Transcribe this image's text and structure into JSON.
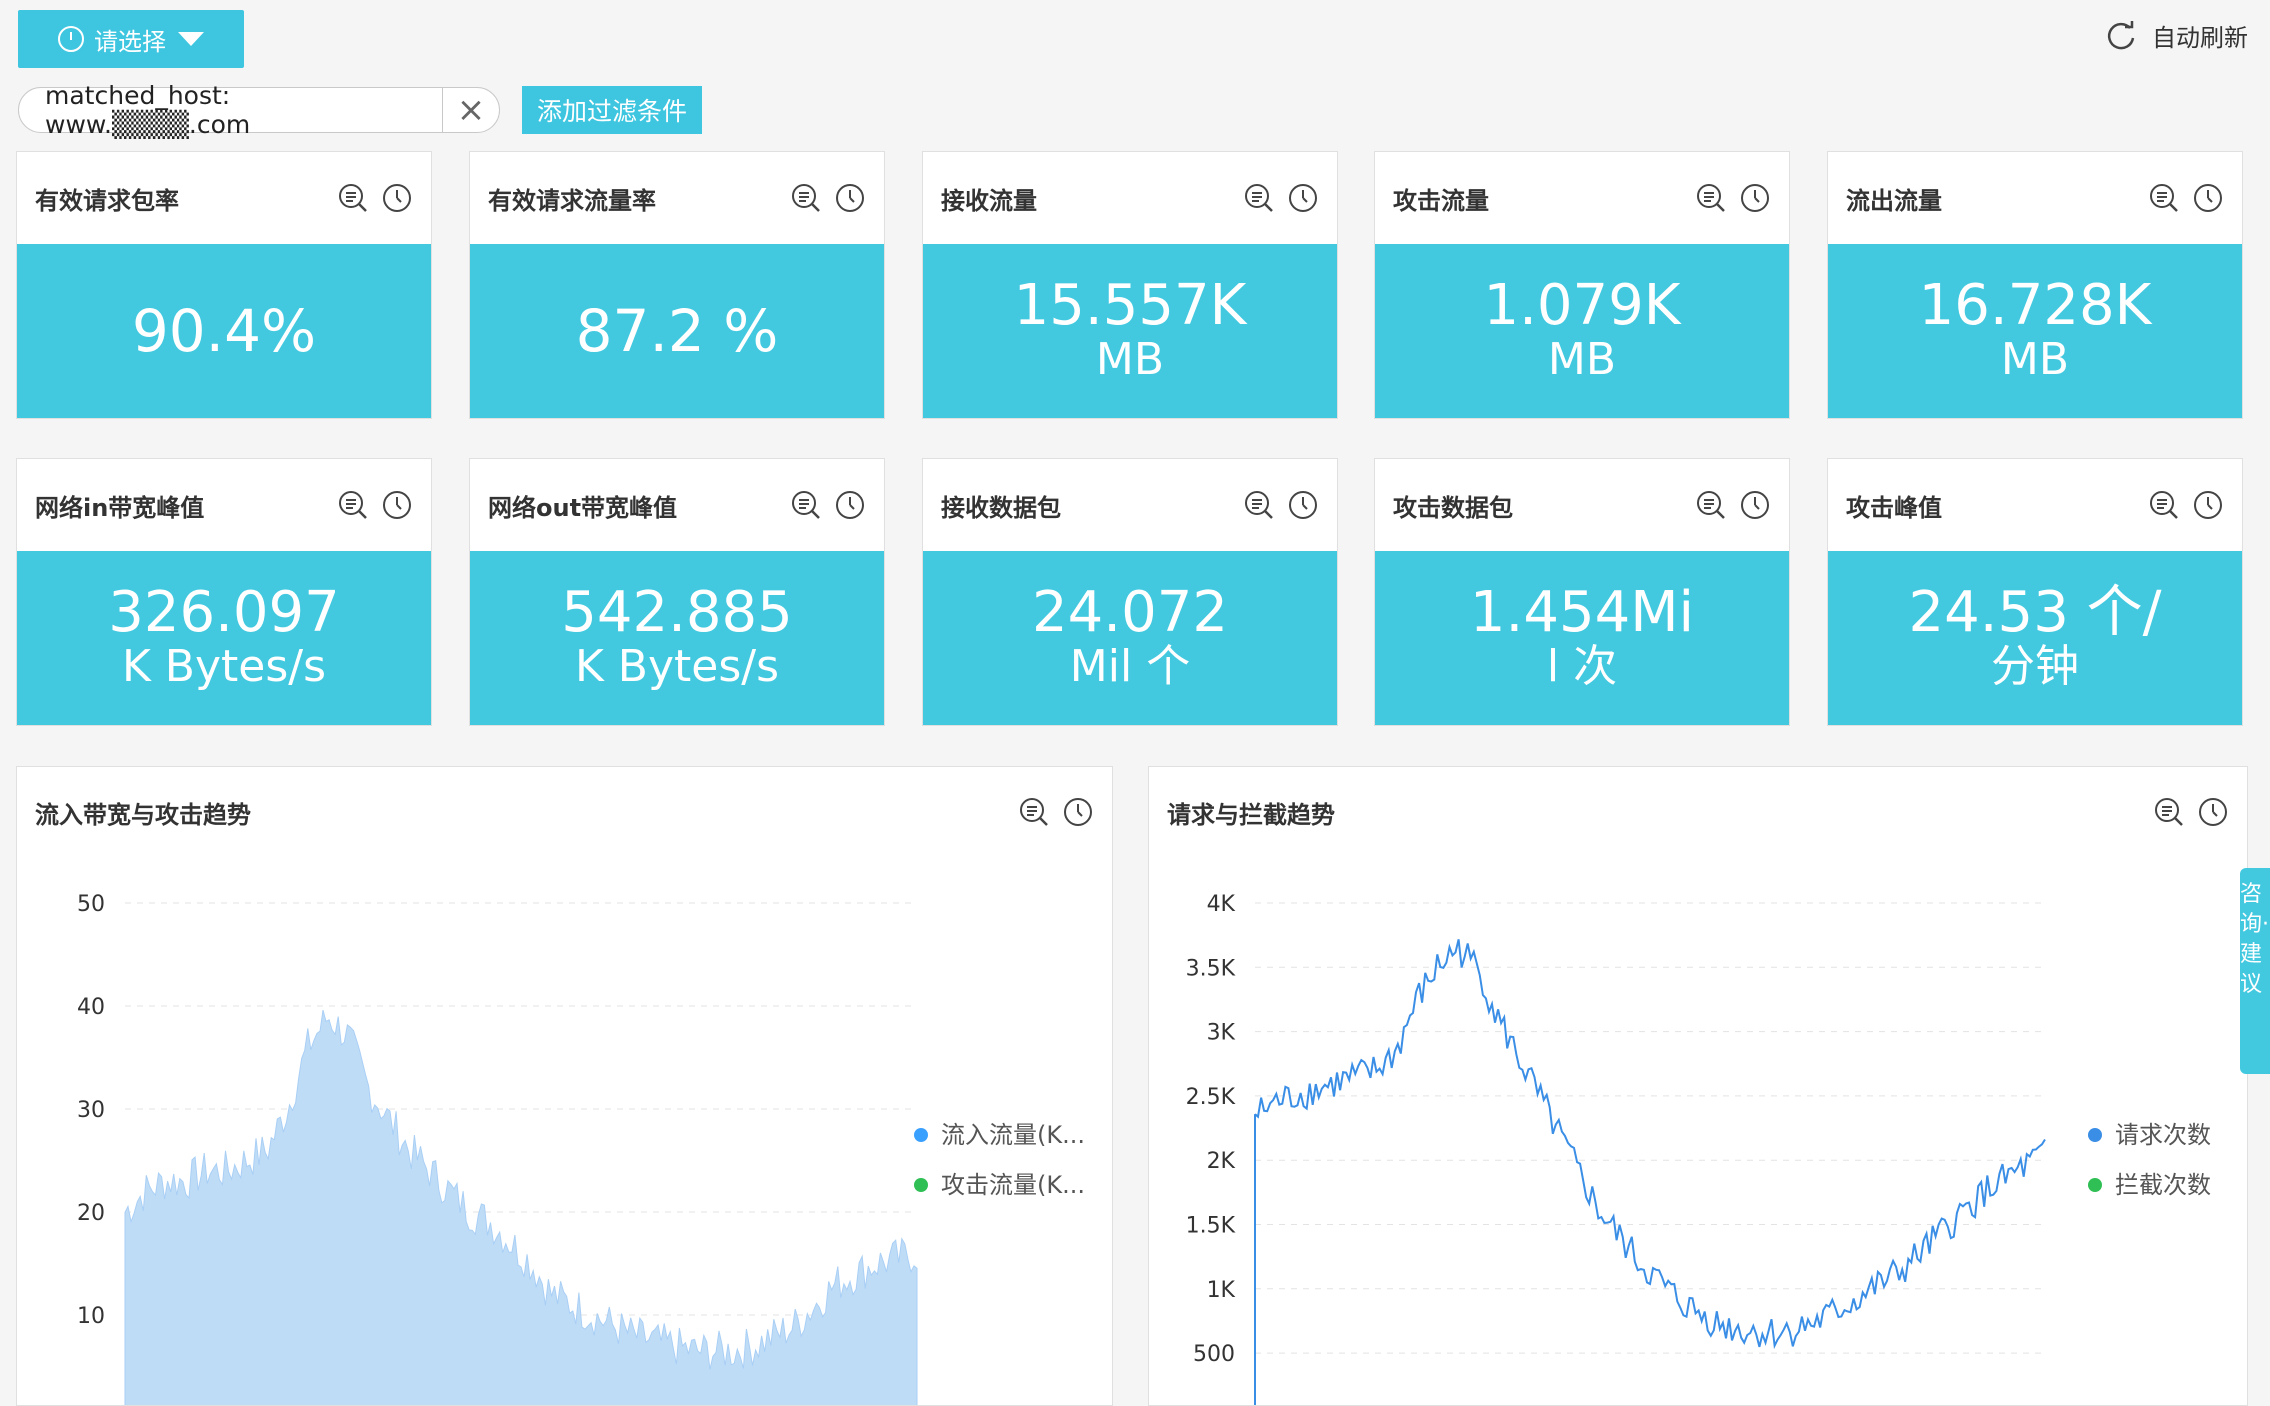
{
  "toolbar": {
    "time_select_label": "请选择",
    "auto_refresh_label": "自动刷新"
  },
  "filter": {
    "text": "matched_host: www.▒▒▒▒.com",
    "add_label": "添加过滤条件"
  },
  "cards": [
    {
      "title": "有效请求包率",
      "value_line1": "90.4%",
      "value_line2": ""
    },
    {
      "title": "有效请求流量率",
      "value_line1": "87.2 %",
      "value_line2": ""
    },
    {
      "title": "接收流量",
      "value_line1": "15.557K",
      "value_line2": "MB"
    },
    {
      "title": "攻击流量",
      "value_line1": "1.079K",
      "value_line2": "MB"
    },
    {
      "title": "流出流量",
      "value_line1": "16.728K",
      "value_line2": "MB"
    },
    {
      "title": "网络in带宽峰值",
      "value_line1": "326.097",
      "value_line2": "K Bytes/s"
    },
    {
      "title": "网络out带宽峰值",
      "value_line1": "542.885",
      "value_line2": "K Bytes/s"
    },
    {
      "title": "接收数据包",
      "value_line1": "24.072",
      "value_line2": "Mil 个"
    },
    {
      "title": "攻击数据包",
      "value_line1": "1.454Mi",
      "value_line2": "l 次"
    },
    {
      "title": "攻击峰值",
      "value_line1": "24.53 个/",
      "value_line2": "分钟"
    }
  ],
  "chart_data": [
    {
      "type": "area",
      "title": "流入带宽与攻击趋势",
      "y_ticks": [
        "50",
        "40",
        "30",
        "20",
        "10"
      ],
      "ylim": [
        0,
        52
      ],
      "series": [
        {
          "name": "流入流量(K...",
          "color": "#3aa0ff",
          "values": [
            20,
            22,
            23,
            23,
            24,
            24,
            25,
            26,
            30,
            36,
            39,
            37,
            32,
            29,
            26,
            24,
            22,
            20,
            19,
            17,
            15,
            12,
            11,
            10,
            9,
            8,
            7.5,
            7,
            6.5,
            6.5,
            6.5,
            7,
            8,
            9,
            11,
            13,
            14,
            15,
            15.5,
            16
          ]
        },
        {
          "name": "攻击流量(K...",
          "color": "#2fbf55",
          "values": [
            0,
            0,
            0,
            0,
            0,
            0,
            0,
            0,
            0,
            0,
            0,
            0,
            0,
            0,
            0,
            0,
            0,
            0,
            0,
            0,
            0,
            0,
            0,
            0,
            0,
            0,
            0,
            0,
            0,
            0,
            0,
            0,
            0,
            0,
            0,
            0,
            0,
            0,
            0,
            0
          ]
        }
      ]
    },
    {
      "type": "line",
      "title": "请求与拦截趋势",
      "y_ticks": [
        "4K",
        "3.5K",
        "3K",
        "2.5K",
        "2K",
        "1.5K",
        "1K",
        "500"
      ],
      "ylim": [
        300,
        4000
      ],
      "series": [
        {
          "name": "请求次数",
          "color": "#3a8ee6",
          "values": [
            2350,
            2450,
            2500,
            2550,
            2600,
            2650,
            2700,
            2850,
            3250,
            3500,
            3650,
            3500,
            3100,
            2800,
            2500,
            2200,
            1900,
            1600,
            1400,
            1200,
            1050,
            900,
            800,
            720,
            680,
            660,
            660,
            700,
            760,
            850,
            950,
            1050,
            1150,
            1300,
            1450,
            1600,
            1750,
            1850,
            1950,
            2050
          ]
        },
        {
          "name": "拦截次数",
          "color": "#2fbf55",
          "values": [
            0,
            0,
            0,
            0,
            0,
            0,
            0,
            0,
            0,
            0,
            0,
            0,
            0,
            0,
            0,
            0,
            0,
            0,
            0,
            0,
            0,
            0,
            0,
            0,
            0,
            0,
            0,
            0,
            0,
            0,
            0,
            0,
            0,
            0,
            0,
            0,
            0,
            0,
            0,
            0
          ]
        }
      ]
    }
  ],
  "feedback": {
    "label": "咨询·建议"
  }
}
